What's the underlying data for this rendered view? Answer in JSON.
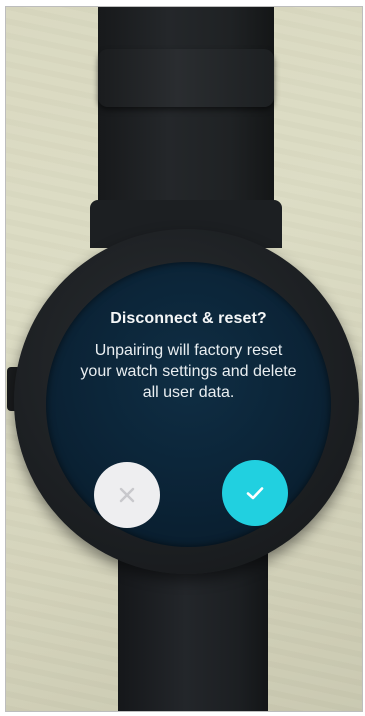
{
  "dialog": {
    "title": "Disconnect & reset?",
    "message": "Unpairing will factory reset your watch settings and delete all user data."
  },
  "actions": {
    "cancel": {
      "icon": "close-icon",
      "color": "#eeeef0",
      "icon_color": "#c8c8cc"
    },
    "confirm": {
      "icon": "check-icon",
      "color": "#21d0e0",
      "icon_color": "#ffffff"
    }
  },
  "colors": {
    "screen_background": "#0b2336",
    "text": "#f4f6f7"
  }
}
